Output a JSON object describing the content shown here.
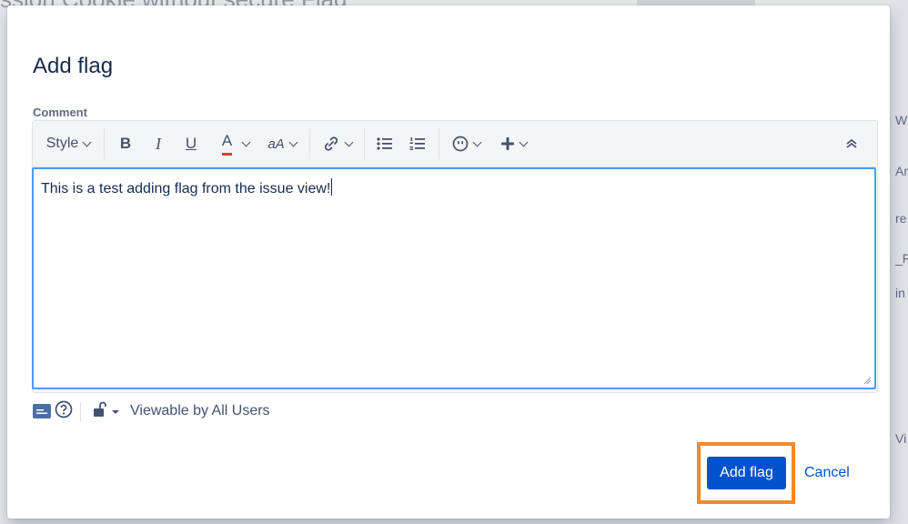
{
  "background": {
    "title_fragment": "ssion Cookie without secure Flag",
    "right_fragments": [
      "W",
      "An",
      "re",
      "_F",
      "in",
      "Vi"
    ]
  },
  "dialog": {
    "title": "Add flag",
    "comment_label": "Comment",
    "toolbar": {
      "style_label": "Style",
      "bold_label": "B",
      "italic_label": "I",
      "underline_label": "U",
      "text_color_label": "A",
      "text_color_underline": "#e53935",
      "more_formatting_label": "aA",
      "icons": [
        "link-icon",
        "bullet-list-icon",
        "numbered-list-icon",
        "emoji-icon",
        "insert-plus-icon",
        "collapse-toolbar-icon"
      ]
    },
    "comment_text": "This is a test adding flag from the issue view!",
    "visibility_label": "Viewable by All Users",
    "primary_button": "Add flag",
    "cancel_button": "Cancel"
  },
  "colors": {
    "primary": "#0052cc",
    "focus_border": "#4c9aff",
    "highlight": "#f28a2c"
  }
}
